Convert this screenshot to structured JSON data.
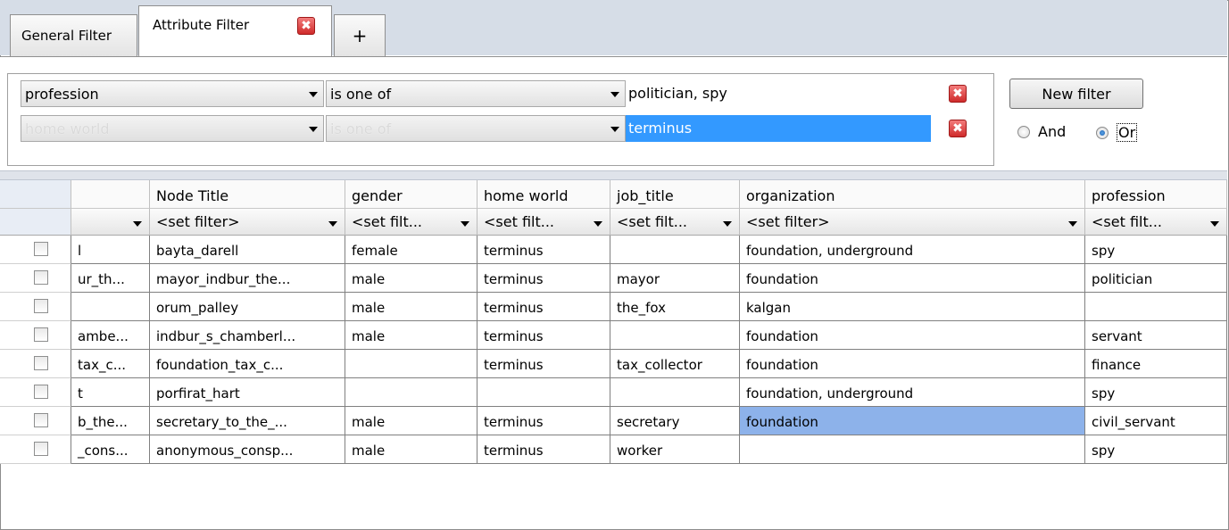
{
  "tabs": {
    "general": "General Filter",
    "attribute": "Attribute Filter",
    "close": "✖",
    "add": "+"
  },
  "filters": {
    "rows": [
      {
        "field": "profession",
        "operator": "is one of",
        "value": "politician, spy",
        "enabled": true
      },
      {
        "field": "home world",
        "operator": "is one of",
        "value": "terminus",
        "enabled": false
      }
    ],
    "new_filter_label": "New filter",
    "combine": {
      "and_label": "And",
      "or_label": "Or",
      "selected": "Or"
    }
  },
  "table": {
    "columns": [
      "",
      "Node Title",
      "gender",
      "home world",
      "job_title",
      "organization",
      "profession"
    ],
    "filter_placeholders": [
      "",
      "<set filter>",
      "<set filt...",
      "<set filt...",
      "<set filt...",
      "<set filter>",
      "<set filt..."
    ],
    "rows": [
      [
        "l",
        "bayta_darell",
        "female",
        "terminus",
        "",
        "foundation, underground",
        "spy"
      ],
      [
        "ur_th...",
        "mayor_indbur_the...",
        "male",
        "terminus",
        "mayor",
        "foundation",
        "politician"
      ],
      [
        "",
        "orum_palley",
        "male",
        "terminus",
        "the_fox",
        "kalgan",
        ""
      ],
      [
        "ambe...",
        "indbur_s_chamberl...",
        "male",
        "terminus",
        "",
        "foundation",
        "servant"
      ],
      [
        "tax_c...",
        "foundation_tax_c...",
        "",
        "terminus",
        "tax_collector",
        "foundation",
        "finance"
      ],
      [
        "t",
        "porfirat_hart",
        "",
        "",
        "",
        "foundation, underground",
        "spy"
      ],
      [
        "b_the...",
        "secretary_to_the_...",
        "male",
        "terminus",
        "secretary",
        "foundation",
        "civil_servant"
      ],
      [
        "_cons...",
        "anonymous_consp...",
        "male",
        "terminus",
        "worker",
        "",
        "spy"
      ]
    ],
    "highlighted_cell": {
      "row": 6,
      "column": "organization"
    }
  }
}
